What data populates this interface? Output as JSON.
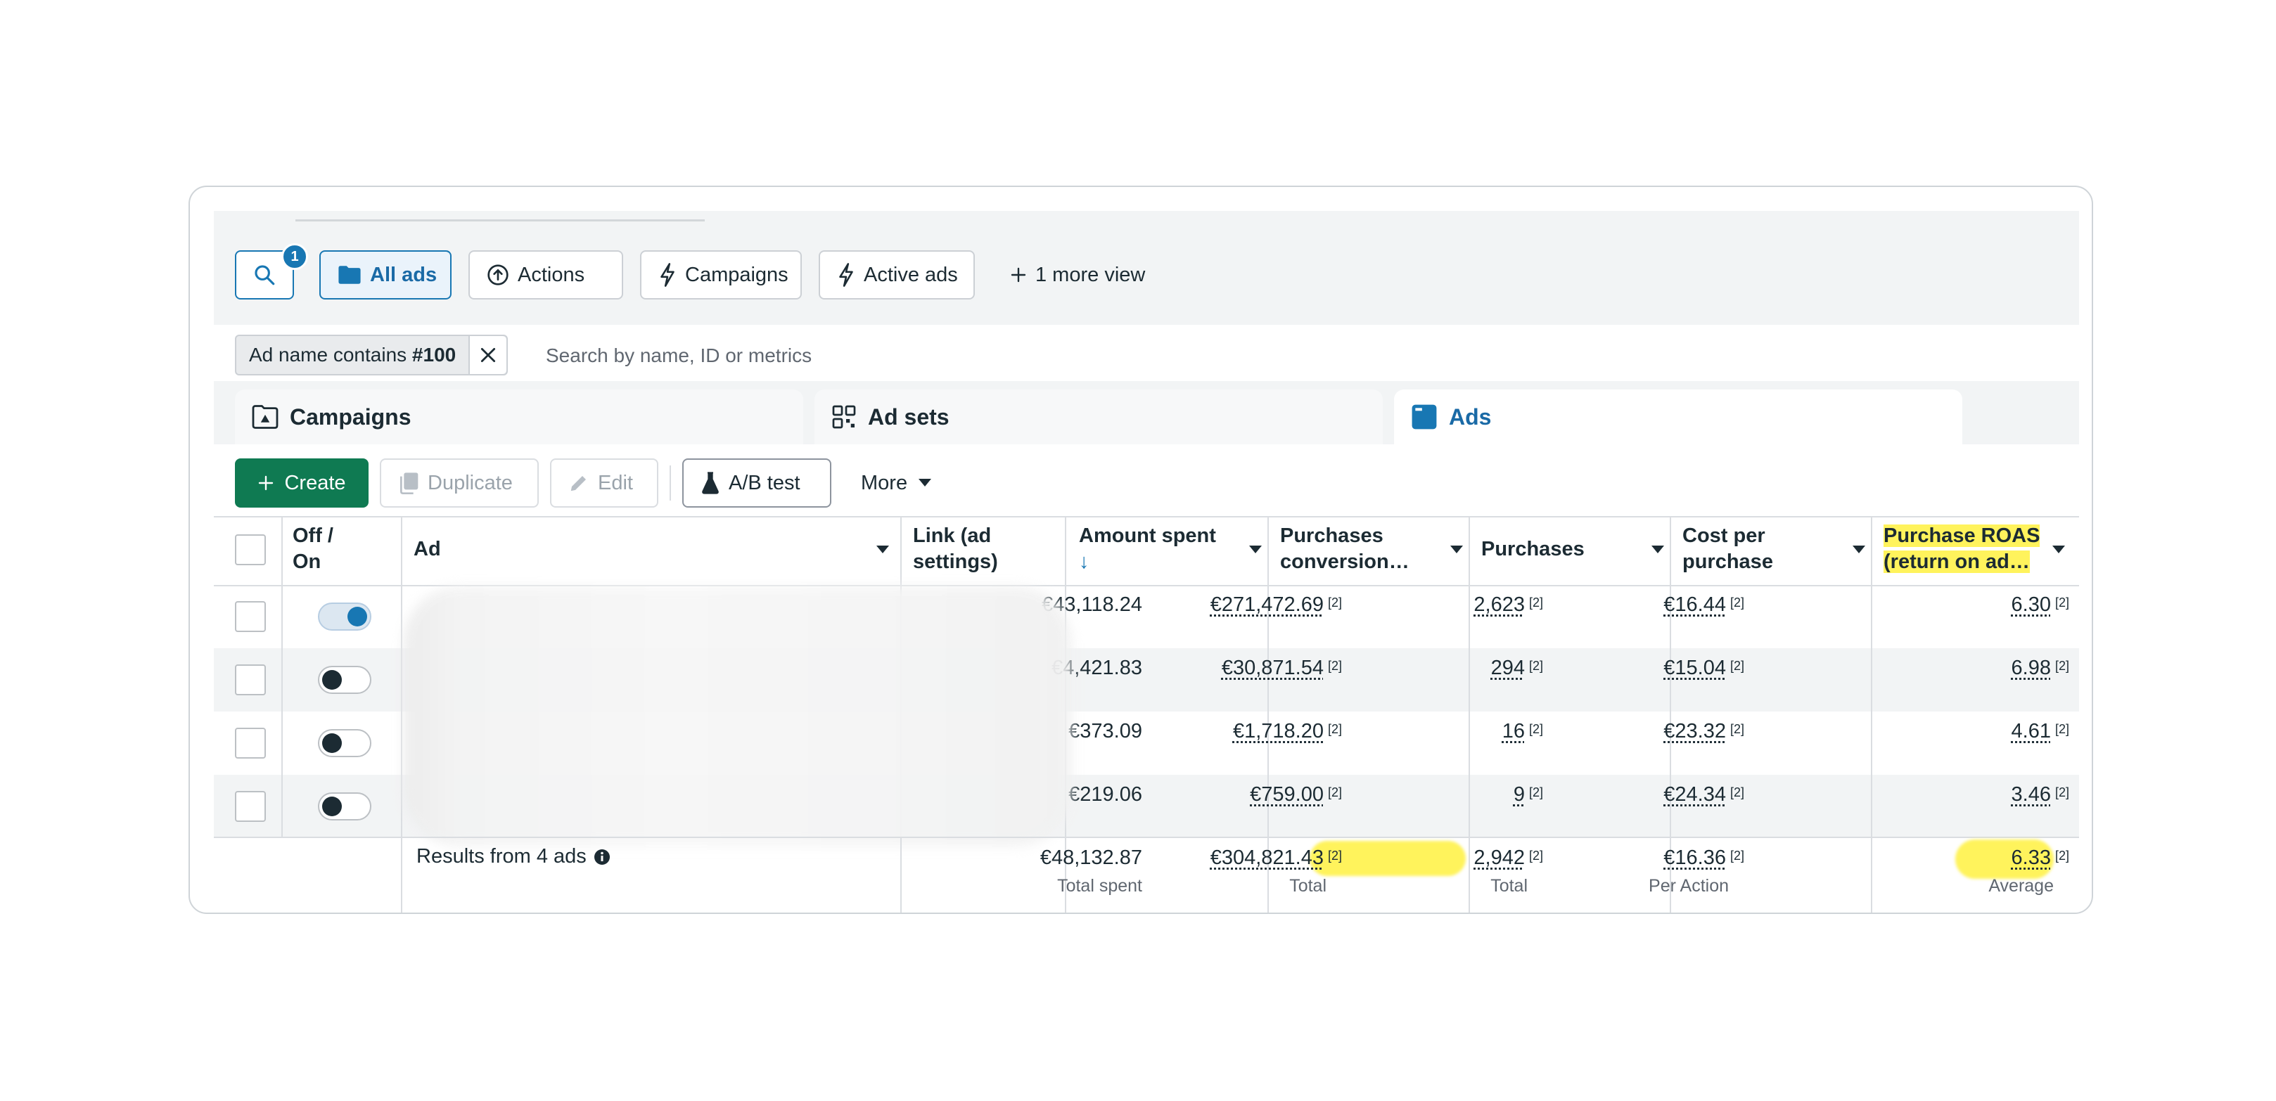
{
  "toolbar": {
    "search_badge": "1",
    "views": [
      "All ads",
      "Actions",
      "Campaigns",
      "Active ads"
    ],
    "more_view": "1 more view"
  },
  "filter": {
    "chip_prefix": "Ad name contains ",
    "chip_value": "#100",
    "placeholder": "Search by name, ID or metrics"
  },
  "levels": {
    "campaigns": "Campaigns",
    "adsets": "Ad sets",
    "ads": "Ads"
  },
  "actions": {
    "create": "Create",
    "duplicate": "Duplicate",
    "edit": "Edit",
    "abtest": "A/B test",
    "more": "More"
  },
  "columns": {
    "offon_1": "Off /",
    "offon_2": "On",
    "ad": "Ad",
    "link_1": "Link (ad",
    "link_2": "settings)",
    "spent_1": "Amount spent",
    "spent_sort": "↓",
    "purch_conv_1": "Purchases",
    "purch_conv_2": "conversion…",
    "purchases": "Purchases",
    "cpp_1": "Cost per",
    "cpp_2": "purchase",
    "roas_1": "Purchase ROAS",
    "roas_2": "(return on ad…"
  },
  "attribution_mark": "[2]",
  "rows": [
    {
      "on": true,
      "spent": "€43,118.24",
      "conv": "€271,472.69",
      "purchases": "2,623",
      "cpp": "€16.44",
      "roas": "6.30"
    },
    {
      "on": false,
      "spent": "€4,421.83",
      "conv": "€30,871.54",
      "purchases": "294",
      "cpp": "€15.04",
      "roas": "6.98"
    },
    {
      "on": false,
      "spent": "€373.09",
      "conv": "€1,718.20",
      "purchases": "16",
      "cpp": "€23.32",
      "roas": "4.61"
    },
    {
      "on": false,
      "spent": "€219.06",
      "conv": "€759.00",
      "purchases": "9",
      "cpp": "€24.34",
      "roas": "3.46"
    }
  ],
  "totals": {
    "label": "Results from 4 ads",
    "spent": "€48,132.87",
    "spent_sub": "Total spent",
    "conv": "€304,821.43",
    "conv_sub": "Total",
    "purchases": "2,942",
    "purchases_sub": "Total",
    "cpp": "€16.36",
    "cpp_sub": "Per Action",
    "roas": "6.33",
    "roas_sub": "Average"
  },
  "colors": {
    "brand": "#1877b3",
    "create": "#0f7a52",
    "highlight": "#fff35c"
  }
}
